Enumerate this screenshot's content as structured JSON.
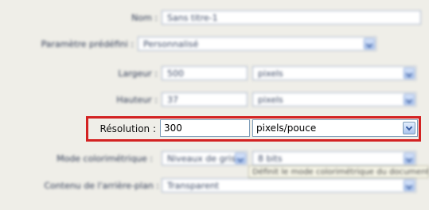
{
  "form": {
    "nom_label": "Nom :",
    "nom_value": "Sans titre-1",
    "preset_label": "Paramètre prédéfini :",
    "preset_value": "Personnalisé",
    "largeur_label": "Largeur :",
    "largeur_value": "500",
    "largeur_unit": "pixels",
    "hauteur_label": "Hauteur :",
    "hauteur_value": "37",
    "hauteur_unit": "pixels",
    "resolution_label": "Résolution :",
    "resolution_value": "300",
    "resolution_unit": "pixels/pouce",
    "mode_label": "Mode colorimétrique :",
    "mode_value": "Niveaux de gris",
    "mode_bits": "8 bits",
    "fond_label": "Contenu de l'arrière-plan :",
    "fond_value": "Transparent"
  },
  "tooltip": {
    "text": "Définit le mode colorimétrique du document"
  },
  "colors": {
    "highlight": "#d32222"
  }
}
